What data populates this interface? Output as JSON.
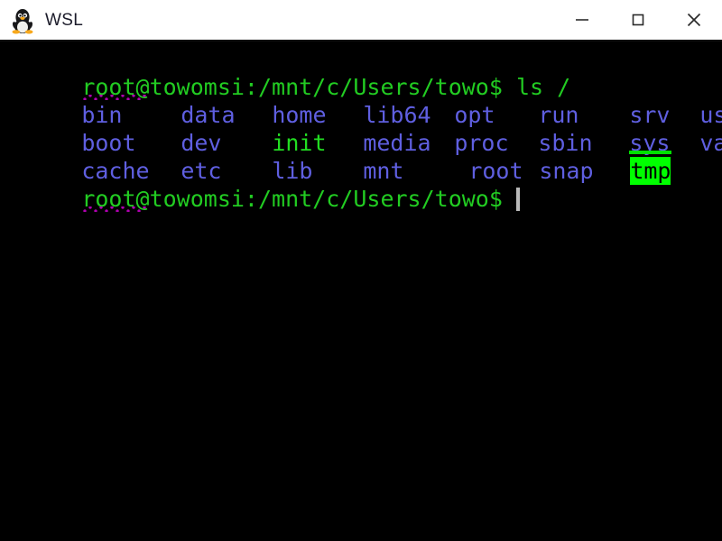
{
  "window": {
    "title": "WSL",
    "icon": "tux-penguin-icon",
    "titlebar_bg": "#ffffff",
    "controls": {
      "minimize": "minimize-icon",
      "maximize": "maximize-icon",
      "close": "close-icon"
    }
  },
  "terminal": {
    "background": "#000000",
    "colors": {
      "prompt_green": "#22cc22",
      "dir_blue": "#5f5fe0",
      "exec_green": "#22dd22",
      "sticky_bg": "#00ff00",
      "sticky_fg": "#000000",
      "squiggle": "#b000b0",
      "cursor": "#b9b9b9"
    },
    "prompt": {
      "user_host": "root@towomsi",
      "separator": ":",
      "path": "/mnt/c/Users/towo",
      "sigil": "$"
    },
    "command": "ls /",
    "lines": [
      {
        "type": "prompt",
        "text": "root@towomsi:/mnt/c/Users/towo$ ls /"
      },
      {
        "type": "output",
        "cells": [
          {
            "text": "bin",
            "style": "dir"
          },
          {
            "text": "data",
            "style": "dir"
          },
          {
            "text": "home",
            "style": "dir"
          },
          {
            "text": "lib64",
            "style": "dir"
          },
          {
            "text": "opt",
            "style": "dir"
          },
          {
            "text": "run",
            "style": "dir"
          },
          {
            "text": "srv",
            "style": "dir"
          },
          {
            "text": "usr",
            "style": "dir"
          }
        ]
      },
      {
        "type": "output",
        "cells": [
          {
            "text": "boot",
            "style": "dir"
          },
          {
            "text": "dev",
            "style": "dir"
          },
          {
            "text": "init",
            "style": "exec"
          },
          {
            "text": "media",
            "style": "dir"
          },
          {
            "text": "proc",
            "style": "dir"
          },
          {
            "text": "sbin",
            "style": "dir"
          },
          {
            "text": "sys",
            "style": "dir-underline"
          },
          {
            "text": "var",
            "style": "dir"
          }
        ]
      },
      {
        "type": "output",
        "cells": [
          {
            "text": "cache",
            "style": "dir"
          },
          {
            "text": "etc",
            "style": "dir"
          },
          {
            "text": "lib",
            "style": "dir"
          },
          {
            "text": "mnt",
            "style": "dir"
          },
          {
            "text": "root",
            "style": "dir"
          },
          {
            "text": "snap",
            "style": "dir"
          },
          {
            "text": "tmp",
            "style": "sticky"
          }
        ]
      },
      {
        "type": "prompt",
        "text": "root@towomsi:/mnt/c/Users/towo$ "
      }
    ]
  }
}
